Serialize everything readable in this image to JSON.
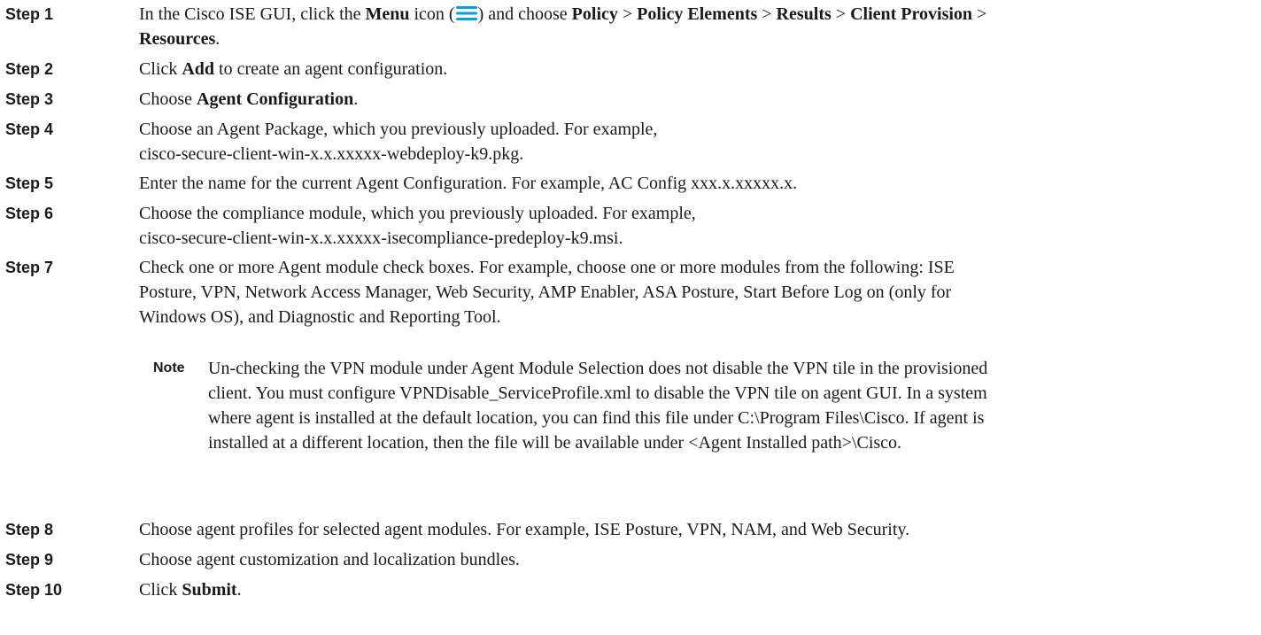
{
  "steps": [
    {
      "label": "Step 1",
      "segments": [
        {
          "t": "In the Cisco ISE GUI, click the "
        },
        {
          "t": "Menu",
          "b": true
        },
        {
          "t": " icon ("
        },
        {
          "icon": "menu-icon"
        },
        {
          "t": ") and choose "
        },
        {
          "t": "Policy",
          "b": true
        },
        {
          "t": " > "
        },
        {
          "t": "Policy Elements",
          "b": true
        },
        {
          "t": " > "
        },
        {
          "t": "Results",
          "b": true
        },
        {
          "t": " > "
        },
        {
          "t": "Client Provision",
          "b": true
        },
        {
          "t": " >"
        },
        {
          "br": true
        },
        {
          "t": "Resources",
          "b": true
        },
        {
          "t": "."
        }
      ]
    },
    {
      "label": "Step 2",
      "segments": [
        {
          "t": "Click "
        },
        {
          "t": "Add",
          "b": true
        },
        {
          "t": " to create an agent configuration."
        }
      ]
    },
    {
      "label": "Step 3",
      "segments": [
        {
          "t": "Choose "
        },
        {
          "t": "Agent Configuration",
          "b": true
        },
        {
          "t": "."
        }
      ]
    },
    {
      "label": "Step 4",
      "segments": [
        {
          "t": "Choose an Agent Package, which you previously uploaded. For example,"
        },
        {
          "br": true
        },
        {
          "t": "cisco-secure-client-win-x.x.xxxxx-webdeploy-k9.pkg."
        }
      ]
    },
    {
      "label": "Step 5",
      "segments": [
        {
          "t": "Enter the name for the current Agent Configuration. For example, AC Config xxx.x.xxxxx.x."
        }
      ]
    },
    {
      "label": "Step 6",
      "segments": [
        {
          "t": "Choose the compliance module, which you previously uploaded. For example,"
        },
        {
          "br": true
        },
        {
          "t": "cisco-secure-client-win-x.x.xxxxx-isecompliance-predeploy-k9.msi."
        }
      ]
    },
    {
      "label": "Step 7",
      "segments": [
        {
          "t": "Check one or more Agent module check boxes. For example, choose one or more modules from the following: ISE"
        },
        {
          "br": true
        },
        {
          "t": "Posture, VPN, Network Access Manager, Web Security, AMP Enabler, ASA Posture, Start Before Log on (only for"
        },
        {
          "br": true
        },
        {
          "t": "Windows OS), and Diagnostic and Reporting Tool."
        }
      ]
    },
    {
      "label": "Step 8",
      "segments": [
        {
          "t": "Choose agent profiles for selected agent modules. For example, ISE Posture, VPN, NAM, and Web Security."
        }
      ]
    },
    {
      "label": "Step 9",
      "segments": [
        {
          "t": "Choose agent customization and localization bundles."
        }
      ]
    },
    {
      "label": "Step 10",
      "segments": [
        {
          "t": "Click "
        },
        {
          "t": "Submit",
          "b": true
        },
        {
          "t": "."
        }
      ]
    }
  ],
  "note": {
    "label": "Note",
    "lines": [
      "Un-checking the VPN module under Agent Module Selection does not disable the VPN tile in the provisioned",
      "client. You must configure VPNDisable_ServiceProfile.xml to disable the VPN tile on agent GUI. In a system",
      "where agent is installed at the default location, you can find this file under C:\\Program Files\\Cisco. If agent is",
      "installed at a different location, then the file will be available under <Agent Installed path>\\Cisco."
    ]
  },
  "colors": {
    "menu_icon": "#049fd9",
    "text": "#1a1a1a"
  }
}
